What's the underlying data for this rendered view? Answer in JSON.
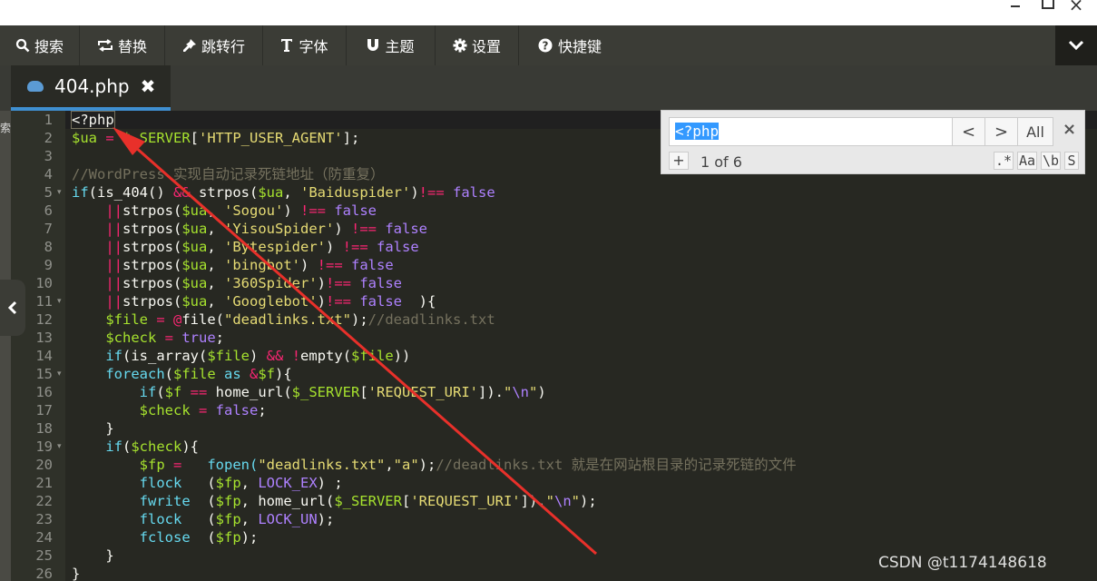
{
  "window": {
    "minimize_icon": "minimize-icon",
    "maximize_icon": "restore-icon",
    "close_glyph": "×"
  },
  "toolbar": {
    "items": [
      {
        "label": "搜索",
        "icon": "search-icon"
      },
      {
        "label": "替换",
        "icon": "replace-icon"
      },
      {
        "label": "跳转行",
        "icon": "pin-icon"
      },
      {
        "label": "字体",
        "icon": "font-icon"
      },
      {
        "label": "主题",
        "icon": "magnet-icon"
      },
      {
        "label": "设置",
        "icon": "gear-icon"
      },
      {
        "label": "快捷键",
        "icon": "help-icon"
      }
    ],
    "collapse_icon": "chevron-down-icon"
  },
  "tab": {
    "filename": "404.php",
    "icon": "php-elephant-icon",
    "close_glyph": "✖"
  },
  "left_strip_text": "索",
  "search": {
    "query": "<?php",
    "prev": "<",
    "next": ">",
    "all": "All",
    "close": "×",
    "add": "+",
    "count": "1 of 6",
    "options": [
      ".*",
      "Aa",
      "\\b",
      "S"
    ]
  },
  "colors": {
    "background": "#272822",
    "keyword": "#66d9ef",
    "operator": "#f92672",
    "string": "#e6db74",
    "variable": "#a6e22e",
    "constant": "#ae81ff",
    "comment": "#75715e"
  },
  "code": {
    "line_numbers": [
      "1",
      "2",
      "3",
      "4",
      "5",
      "6",
      "7",
      "8",
      "9",
      "10",
      "11",
      "12",
      "13",
      "14",
      "15",
      "16",
      "17",
      "18",
      "19",
      "20",
      "21",
      "22",
      "23",
      "24",
      "25",
      "26"
    ],
    "fold_lines": [
      5,
      11,
      15,
      19
    ],
    "lines": [
      [
        {
          "t": "<?php",
          "c": "#f8f8f2",
          "sel": true
        }
      ],
      [
        {
          "t": "$ua",
          "c": "#a6e22e"
        },
        {
          "t": " = ",
          "c": "#f92672"
        },
        {
          "t": "$_SERVER",
          "c": "#a6e22e"
        },
        {
          "t": "[",
          "c": "#f8f8f2"
        },
        {
          "t": "'HTTP_USER_AGENT'",
          "c": "#e6db74"
        },
        {
          "t": "];",
          "c": "#f8f8f2"
        }
      ],
      [],
      [
        {
          "t": "//WordPress 实现自动记录死链地址（防重复）",
          "c": "#75715e"
        }
      ],
      [
        {
          "t": "if",
          "c": "#66d9ef"
        },
        {
          "t": "(is_404() ",
          "c": "#f8f8f2"
        },
        {
          "t": "&&",
          "c": "#f92672"
        },
        {
          "t": " strpos(",
          "c": "#f8f8f2"
        },
        {
          "t": "$ua",
          "c": "#a6e22e"
        },
        {
          "t": ", ",
          "c": "#f8f8f2"
        },
        {
          "t": "'Baiduspider'",
          "c": "#e6db74"
        },
        {
          "t": ")",
          "c": "#f8f8f2"
        },
        {
          "t": "!==",
          "c": "#f92672"
        },
        {
          "t": " false",
          "c": "#ae81ff"
        }
      ],
      [
        {
          "t": "    ",
          "c": "#f8f8f2"
        },
        {
          "t": "||",
          "c": "#f92672"
        },
        {
          "t": "strpos(",
          "c": "#f8f8f2"
        },
        {
          "t": "$ua",
          "c": "#a6e22e"
        },
        {
          "t": ", ",
          "c": "#f8f8f2"
        },
        {
          "t": "'Sogou'",
          "c": "#e6db74"
        },
        {
          "t": ") ",
          "c": "#f8f8f2"
        },
        {
          "t": "!==",
          "c": "#f92672"
        },
        {
          "t": " false",
          "c": "#ae81ff"
        }
      ],
      [
        {
          "t": "    ",
          "c": "#f8f8f2"
        },
        {
          "t": "||",
          "c": "#f92672"
        },
        {
          "t": "strpos(",
          "c": "#f8f8f2"
        },
        {
          "t": "$ua",
          "c": "#a6e22e"
        },
        {
          "t": ", ",
          "c": "#f8f8f2"
        },
        {
          "t": "'YisouSpider'",
          "c": "#e6db74"
        },
        {
          "t": ") ",
          "c": "#f8f8f2"
        },
        {
          "t": "!==",
          "c": "#f92672"
        },
        {
          "t": " false",
          "c": "#ae81ff"
        }
      ],
      [
        {
          "t": "    ",
          "c": "#f8f8f2"
        },
        {
          "t": "||",
          "c": "#f92672"
        },
        {
          "t": "strpos(",
          "c": "#f8f8f2"
        },
        {
          "t": "$ua",
          "c": "#a6e22e"
        },
        {
          "t": ", ",
          "c": "#f8f8f2"
        },
        {
          "t": "'Bytespider'",
          "c": "#e6db74"
        },
        {
          "t": ") ",
          "c": "#f8f8f2"
        },
        {
          "t": "!==",
          "c": "#f92672"
        },
        {
          "t": " false",
          "c": "#ae81ff"
        }
      ],
      [
        {
          "t": "    ",
          "c": "#f8f8f2"
        },
        {
          "t": "||",
          "c": "#f92672"
        },
        {
          "t": "strpos(",
          "c": "#f8f8f2"
        },
        {
          "t": "$ua",
          "c": "#a6e22e"
        },
        {
          "t": ", ",
          "c": "#f8f8f2"
        },
        {
          "t": "'bingbot'",
          "c": "#e6db74"
        },
        {
          "t": ") ",
          "c": "#f8f8f2"
        },
        {
          "t": "!==",
          "c": "#f92672"
        },
        {
          "t": " false",
          "c": "#ae81ff"
        }
      ],
      [
        {
          "t": "    ",
          "c": "#f8f8f2"
        },
        {
          "t": "||",
          "c": "#f92672"
        },
        {
          "t": "strpos(",
          "c": "#f8f8f2"
        },
        {
          "t": "$ua",
          "c": "#a6e22e"
        },
        {
          "t": ", ",
          "c": "#f8f8f2"
        },
        {
          "t": "'360Spider'",
          "c": "#e6db74"
        },
        {
          "t": ")",
          "c": "#f8f8f2"
        },
        {
          "t": "!==",
          "c": "#f92672"
        },
        {
          "t": " false",
          "c": "#ae81ff"
        }
      ],
      [
        {
          "t": "    ",
          "c": "#f8f8f2"
        },
        {
          "t": "||",
          "c": "#f92672"
        },
        {
          "t": "strpos(",
          "c": "#f8f8f2"
        },
        {
          "t": "$ua",
          "c": "#a6e22e"
        },
        {
          "t": ", ",
          "c": "#f8f8f2"
        },
        {
          "t": "'Googlebot'",
          "c": "#e6db74"
        },
        {
          "t": ")",
          "c": "#f8f8f2"
        },
        {
          "t": "!==",
          "c": "#f92672"
        },
        {
          "t": " false",
          "c": "#ae81ff"
        },
        {
          "t": "  ){",
          "c": "#f8f8f2"
        }
      ],
      [
        {
          "t": "    ",
          "c": "#f8f8f2"
        },
        {
          "t": "$file",
          "c": "#a6e22e"
        },
        {
          "t": " = ",
          "c": "#f92672"
        },
        {
          "t": "@",
          "c": "#f92672"
        },
        {
          "t": "file(",
          "c": "#f8f8f2"
        },
        {
          "t": "\"deadlinks.txt\"",
          "c": "#e6db74"
        },
        {
          "t": ");",
          "c": "#f8f8f2"
        },
        {
          "t": "//deadlinks.txt",
          "c": "#75715e"
        }
      ],
      [
        {
          "t": "    ",
          "c": "#f8f8f2"
        },
        {
          "t": "$check",
          "c": "#a6e22e"
        },
        {
          "t": " = ",
          "c": "#f92672"
        },
        {
          "t": "true",
          "c": "#ae81ff"
        },
        {
          "t": ";",
          "c": "#f8f8f2"
        }
      ],
      [
        {
          "t": "    ",
          "c": "#f8f8f2"
        },
        {
          "t": "if",
          "c": "#66d9ef"
        },
        {
          "t": "(is_array(",
          "c": "#f8f8f2"
        },
        {
          "t": "$file",
          "c": "#a6e22e"
        },
        {
          "t": ") ",
          "c": "#f8f8f2"
        },
        {
          "t": "&&",
          "c": "#f92672"
        },
        {
          "t": " ",
          "c": "#f8f8f2"
        },
        {
          "t": "!",
          "c": "#f92672"
        },
        {
          "t": "empty(",
          "c": "#f8f8f2"
        },
        {
          "t": "$file",
          "c": "#a6e22e"
        },
        {
          "t": "))",
          "c": "#f8f8f2"
        }
      ],
      [
        {
          "t": "    ",
          "c": "#f8f8f2"
        },
        {
          "t": "foreach",
          "c": "#66d9ef"
        },
        {
          "t": "(",
          "c": "#f8f8f2"
        },
        {
          "t": "$file",
          "c": "#a6e22e"
        },
        {
          "t": " as ",
          "c": "#66d9ef"
        },
        {
          "t": "&",
          "c": "#f92672"
        },
        {
          "t": "$f",
          "c": "#a6e22e"
        },
        {
          "t": "){",
          "c": "#f8f8f2"
        }
      ],
      [
        {
          "t": "        ",
          "c": "#f8f8f2"
        },
        {
          "t": "if",
          "c": "#66d9ef"
        },
        {
          "t": "(",
          "c": "#f8f8f2"
        },
        {
          "t": "$f",
          "c": "#a6e22e"
        },
        {
          "t": " == ",
          "c": "#f92672"
        },
        {
          "t": "home_url(",
          "c": "#f8f8f2"
        },
        {
          "t": "$_SERVER",
          "c": "#a6e22e"
        },
        {
          "t": "[",
          "c": "#f8f8f2"
        },
        {
          "t": "'REQUEST_URI'",
          "c": "#e6db74"
        },
        {
          "t": "]).",
          "c": "#f8f8f2"
        },
        {
          "t": "\"",
          "c": "#e6db74"
        },
        {
          "t": "\\n",
          "c": "#ae81ff"
        },
        {
          "t": "\"",
          "c": "#e6db74"
        },
        {
          "t": ")",
          "c": "#f8f8f2"
        }
      ],
      [
        {
          "t": "        ",
          "c": "#f8f8f2"
        },
        {
          "t": "$check",
          "c": "#a6e22e"
        },
        {
          "t": " = ",
          "c": "#f92672"
        },
        {
          "t": "false",
          "c": "#ae81ff"
        },
        {
          "t": ";",
          "c": "#f8f8f2"
        }
      ],
      [
        {
          "t": "    }",
          "c": "#f8f8f2"
        }
      ],
      [
        {
          "t": "    ",
          "c": "#f8f8f2"
        },
        {
          "t": "if",
          "c": "#66d9ef"
        },
        {
          "t": "(",
          "c": "#f8f8f2"
        },
        {
          "t": "$check",
          "c": "#a6e22e"
        },
        {
          "t": "){",
          "c": "#f8f8f2"
        }
      ],
      [
        {
          "t": "        ",
          "c": "#f8f8f2"
        },
        {
          "t": "$fp",
          "c": "#a6e22e"
        },
        {
          "t": " =   ",
          "c": "#f92672"
        },
        {
          "t": "fopen(",
          "c": "#66d9ef"
        },
        {
          "t": "\"deadlinks.txt\"",
          "c": "#e6db74"
        },
        {
          "t": ",",
          "c": "#f8f8f2"
        },
        {
          "t": "\"a\"",
          "c": "#e6db74"
        },
        {
          "t": ");",
          "c": "#f8f8f2"
        },
        {
          "t": "//deadlinks.txt 就是在网站根目录的记录死链的文件",
          "c": "#75715e"
        }
      ],
      [
        {
          "t": "        ",
          "c": "#f8f8f2"
        },
        {
          "t": "flock",
          "c": "#66d9ef"
        },
        {
          "t": "   (",
          "c": "#f8f8f2"
        },
        {
          "t": "$fp",
          "c": "#a6e22e"
        },
        {
          "t": ", ",
          "c": "#f8f8f2"
        },
        {
          "t": "LOCK_EX",
          "c": "#ae81ff"
        },
        {
          "t": ") ;",
          "c": "#f8f8f2"
        }
      ],
      [
        {
          "t": "        ",
          "c": "#f8f8f2"
        },
        {
          "t": "fwrite",
          "c": "#66d9ef"
        },
        {
          "t": "  (",
          "c": "#f8f8f2"
        },
        {
          "t": "$fp",
          "c": "#a6e22e"
        },
        {
          "t": ", home_url(",
          "c": "#f8f8f2"
        },
        {
          "t": "$_SERVER",
          "c": "#a6e22e"
        },
        {
          "t": "[",
          "c": "#f8f8f2"
        },
        {
          "t": "'REQUEST_URI'",
          "c": "#e6db74"
        },
        {
          "t": "]).",
          "c": "#f8f8f2"
        },
        {
          "t": "\"",
          "c": "#e6db74"
        },
        {
          "t": "\\n",
          "c": "#ae81ff"
        },
        {
          "t": "\"",
          "c": "#e6db74"
        },
        {
          "t": ");",
          "c": "#f8f8f2"
        }
      ],
      [
        {
          "t": "        ",
          "c": "#f8f8f2"
        },
        {
          "t": "flock",
          "c": "#66d9ef"
        },
        {
          "t": "   (",
          "c": "#f8f8f2"
        },
        {
          "t": "$fp",
          "c": "#a6e22e"
        },
        {
          "t": ", ",
          "c": "#f8f8f2"
        },
        {
          "t": "LOCK_UN",
          "c": "#ae81ff"
        },
        {
          "t": ");",
          "c": "#f8f8f2"
        }
      ],
      [
        {
          "t": "        ",
          "c": "#f8f8f2"
        },
        {
          "t": "fclose",
          "c": "#66d9ef"
        },
        {
          "t": "  (",
          "c": "#f8f8f2"
        },
        {
          "t": "$fp",
          "c": "#a6e22e"
        },
        {
          "t": ");",
          "c": "#f8f8f2"
        }
      ],
      [
        {
          "t": "    }",
          "c": "#f8f8f2"
        }
      ],
      [
        {
          "t": "}",
          "c": "#f8f8f2"
        }
      ]
    ]
  },
  "watermark": "CSDN @t1174148618",
  "annotation": {
    "arrow_color": "#e8302a"
  }
}
